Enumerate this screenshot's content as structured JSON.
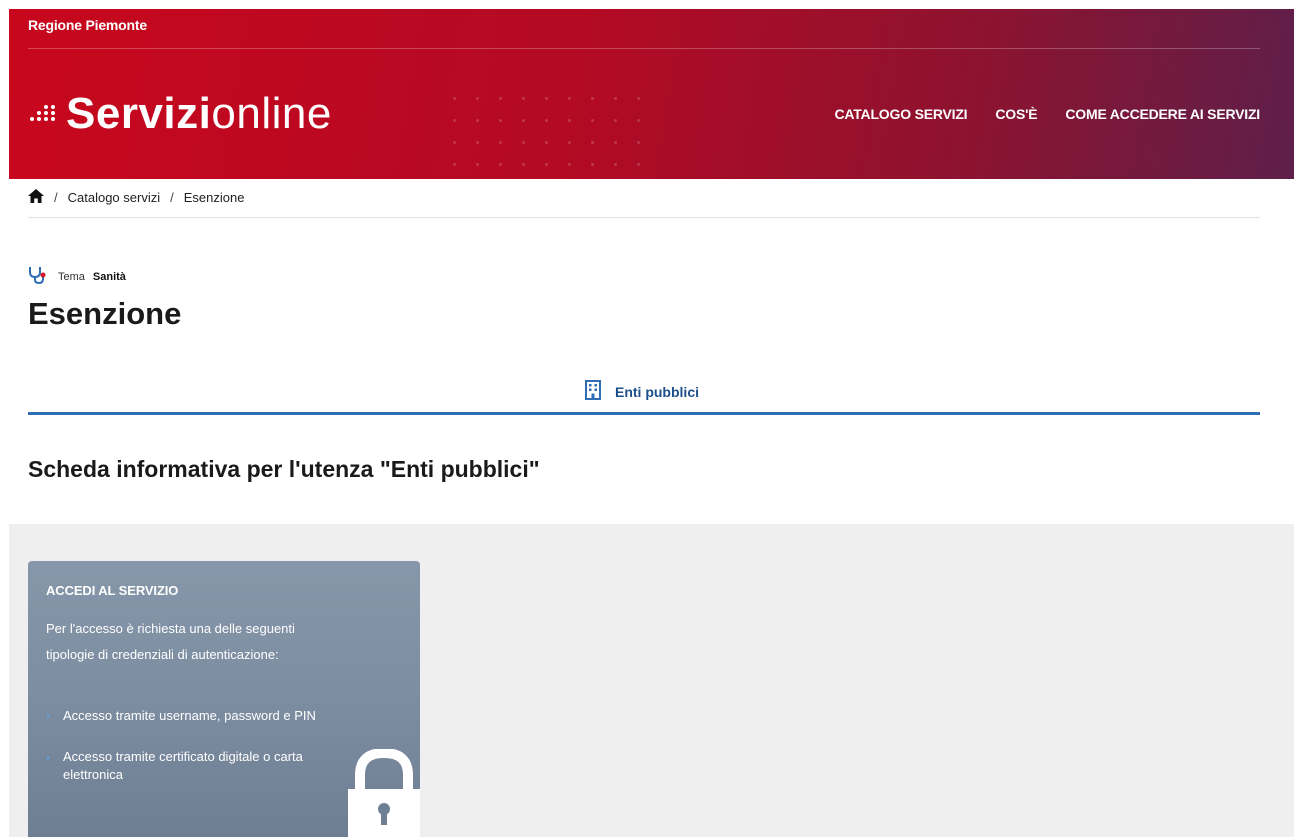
{
  "header": {
    "region": "Regione Piemonte",
    "logo_strong": "Servizi",
    "logo_light": "online",
    "nav": [
      "CATALOGO SERVIZI",
      "COS'È",
      "COME ACCEDERE AI SERVIZI"
    ]
  },
  "breadcrumb": {
    "home_icon": "home-icon",
    "items": [
      "Catalogo servizi",
      "Esenzione"
    ],
    "separator": "/"
  },
  "theme": {
    "icon": "stethoscope-icon",
    "label": "Tema",
    "value": "Sanità"
  },
  "page": {
    "title": "Esenzione",
    "tab": {
      "icon": "building-icon",
      "label": "Enti pubblici"
    },
    "subtitle": "Scheda informativa per l'utenza \"Enti pubblici\""
  },
  "card": {
    "title": "ACCEDI AL SERVIZIO",
    "description": "Per l'accesso è richiesta una delle seguenti tipologie di credenziali di autenticazione:",
    "items": [
      "Accesso tramite username, password e PIN",
      "Accesso tramite certificato digitale o carta elettronica"
    ],
    "icon": "lock-icon"
  },
  "colors": {
    "header_red": "#c8071d",
    "header_purple": "#5e1f4a",
    "accent_blue": "#2f6db4",
    "card_bg": "#8797aa",
    "panel_bg": "#efefef"
  }
}
